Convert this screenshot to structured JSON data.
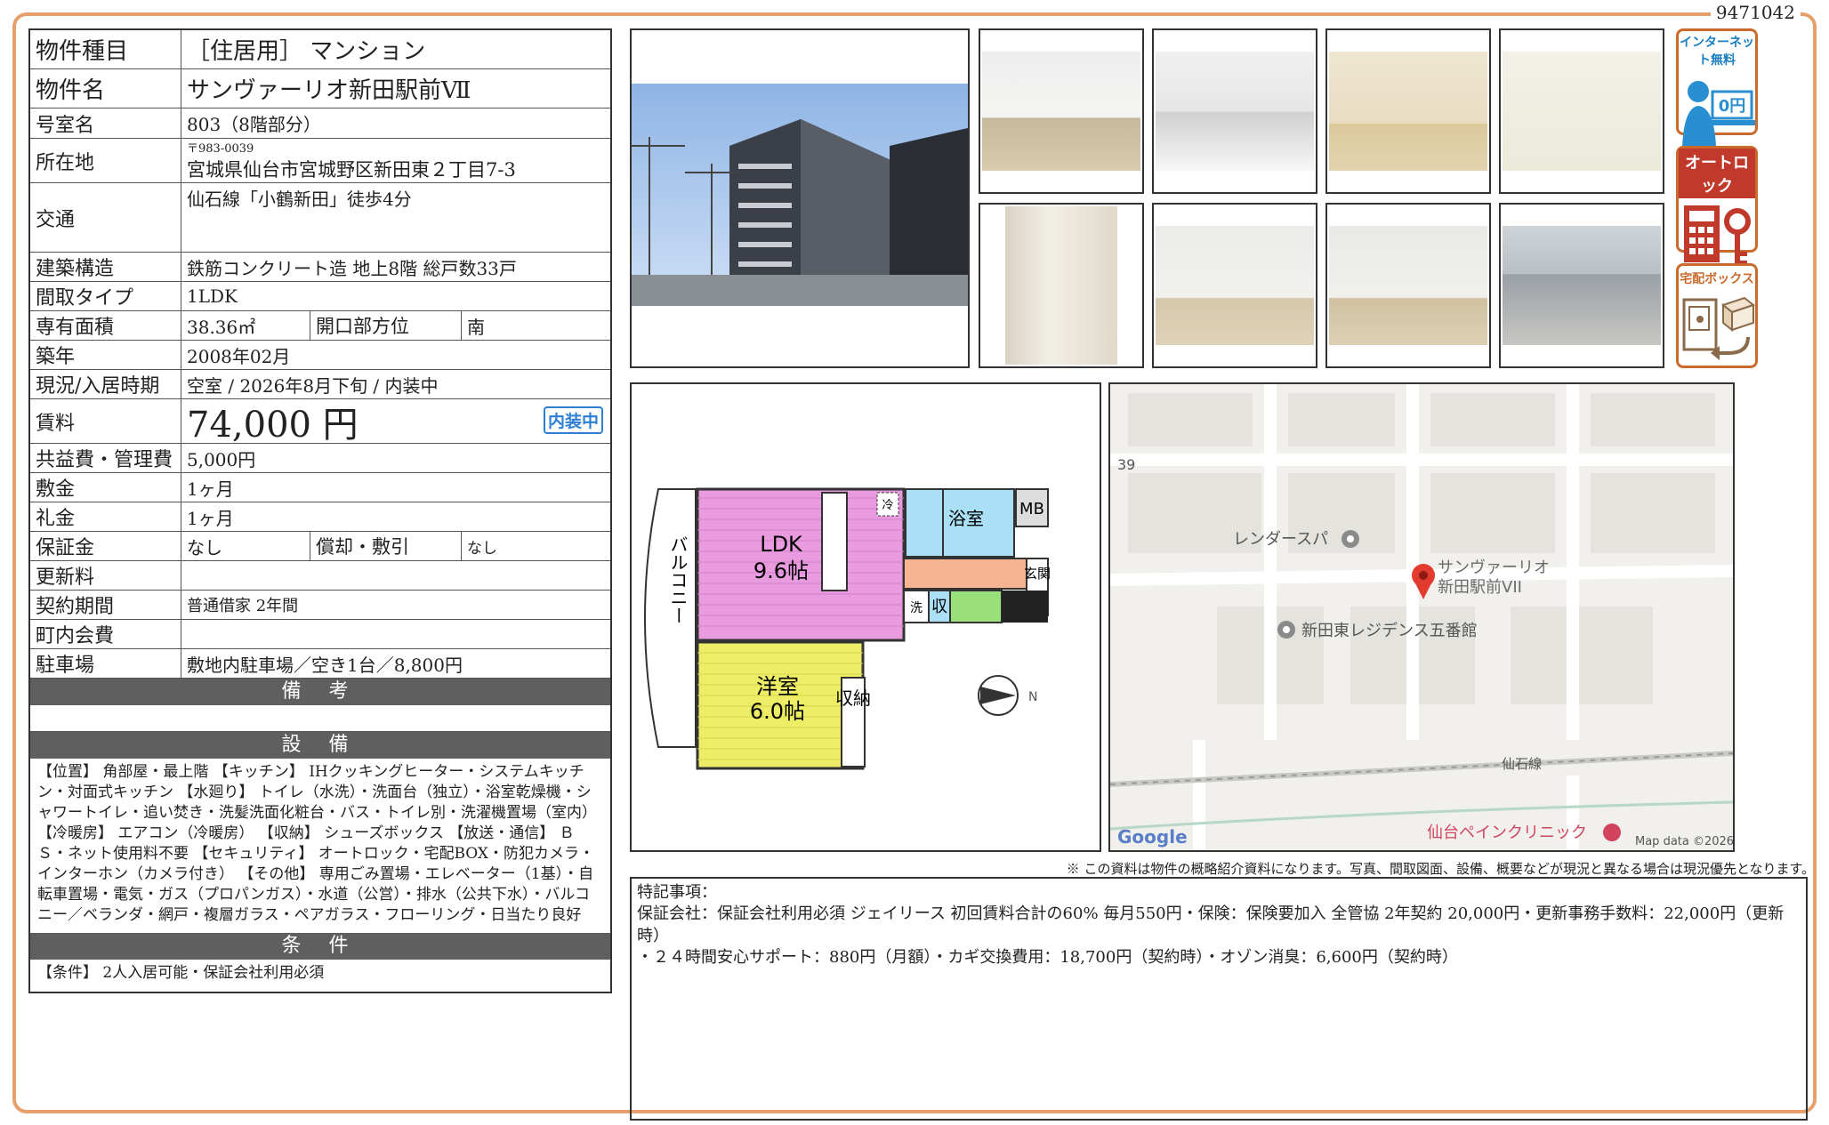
{
  "doc_number": "9471042",
  "spec": {
    "type_label": "物件種目",
    "type_value": "［住居用］ マンション",
    "name_label": "物件名",
    "name_value": "サンヴァーリオ新田駅前Ⅶ",
    "room_label": "号室名",
    "room_value": "803（8階部分）",
    "address_label": "所在地",
    "postal": "〒983-0039",
    "address_value": "宮城県仙台市宮城野区新田東２丁目7-3",
    "transport_label": "交通",
    "transport_value": "仙石線「小鶴新田」徒歩4分",
    "structure_label": "建築構造",
    "structure_value": "鉄筋コンクリート造 地上8階 総戸数33戸",
    "layout_label": "間取タイプ",
    "layout_value": "1LDK",
    "area_label": "専有面積",
    "area_value": "38.36㎡",
    "direction_label": "開口部方位",
    "direction_value": "南",
    "built_label": "築年",
    "built_value": "2008年02月",
    "status_label": "現況/入居時期",
    "status_value": "空室 / 2026年8月下旬 / 内装中",
    "rent_label": "賃料",
    "rent_value": "74,000 円",
    "rent_badge": "内装中",
    "fee_label": "共益費・管理費",
    "fee_value": "5,000円",
    "deposit_label": "敷金",
    "deposit_value": "1ヶ月",
    "key_label": "礼金",
    "key_value": "1ヶ月",
    "guarantee_label": "保証金",
    "guarantee_value": "なし",
    "amort_label": "償却・敷引",
    "amort_value": "なし",
    "renewal_label": "更新料",
    "renewal_value": "",
    "contract_label": "契約期間",
    "contract_value": "普通借家 2年間",
    "assoc_label": "町内会費",
    "assoc_value": "",
    "parking_label": "駐車場",
    "parking_value": "敷地内駐車場／空き1台／8,800円"
  },
  "sections": {
    "remarks_title": "備 考",
    "remarks_text": "",
    "equip_title": "設 備",
    "equip_text": "【位置】 角部屋・最上階 【キッチン】 IHクッキングヒーター・システムキッチン・対面式キッチン 【水廻り】 トイレ（水洗）・洗面台（独立）・浴室乾燥機・シャワートイレ・追い焚き・洗髪洗面化粧台・バス・トイレ別・洗濯機置場（室内） 【冷暖房】 エアコン（冷暖房） 【収納】 シューズボックス 【放送・通信】 ＢＳ・ネット使用料不要 【セキュリティ】 オートロック・宅配BOX・防犯カメラ・インターホン（カメラ付き） 【その他】 専用ごみ置場・エレベーター（1基）・自転車置場・電気・ガス（プロパンガス）・水道（公営）・排水（公共下水）・バルコニー／ベランダ・網戸・複層ガラス・ペアガラス・フローリング・日当たり良好",
    "cond_title": "条 件",
    "cond_text": "【条件】 2人入居可能・保証会社利用必須"
  },
  "icons": {
    "internet": "インターネット無料",
    "internet_price": "0円",
    "autolock": "オートロック",
    "delivery": "宅配ボックス"
  },
  "floorplan": {
    "ldk": "LDK",
    "ldk_size": "9.6帖",
    "western": "洋室",
    "western_size": "6.0帖",
    "balcony": "バルコニー",
    "storage": "収納",
    "storage2": "収",
    "bath": "浴室",
    "mb": "MB",
    "entrance": "玄関",
    "wash": "洗",
    "fridge": "冷",
    "north": "N"
  },
  "map": {
    "label1": "レンダースパ",
    "label2": "サンヴァーリオ",
    "label2b": "新田駅前VII",
    "label3": "新田東レジデンス五番館",
    "label4": "仙石線",
    "label5": "仙台ペインクリニック",
    "road": "39",
    "brand": "Google",
    "credit": "Map data ©2026"
  },
  "disclaimer": "※ この資料は物件の概略紹介資料になります。写真、間取図面、設備、概要などが現況と異なる場合は現況優先となります。",
  "notes": {
    "title": "特記事項：",
    "line1": "保証会社：保証会社利用必須 ジェイリース 初回賃料合計の60% 毎月550円・保険：保険要加入 全管協 2年契約 20,000円・更新事務手数料：22,000円（更新時）",
    "line2": "・２４時間安心サポート：880円（月額）・カギ交換費用：18,700円（契約時）・オゾン消臭：6,600円（契約時）"
  }
}
